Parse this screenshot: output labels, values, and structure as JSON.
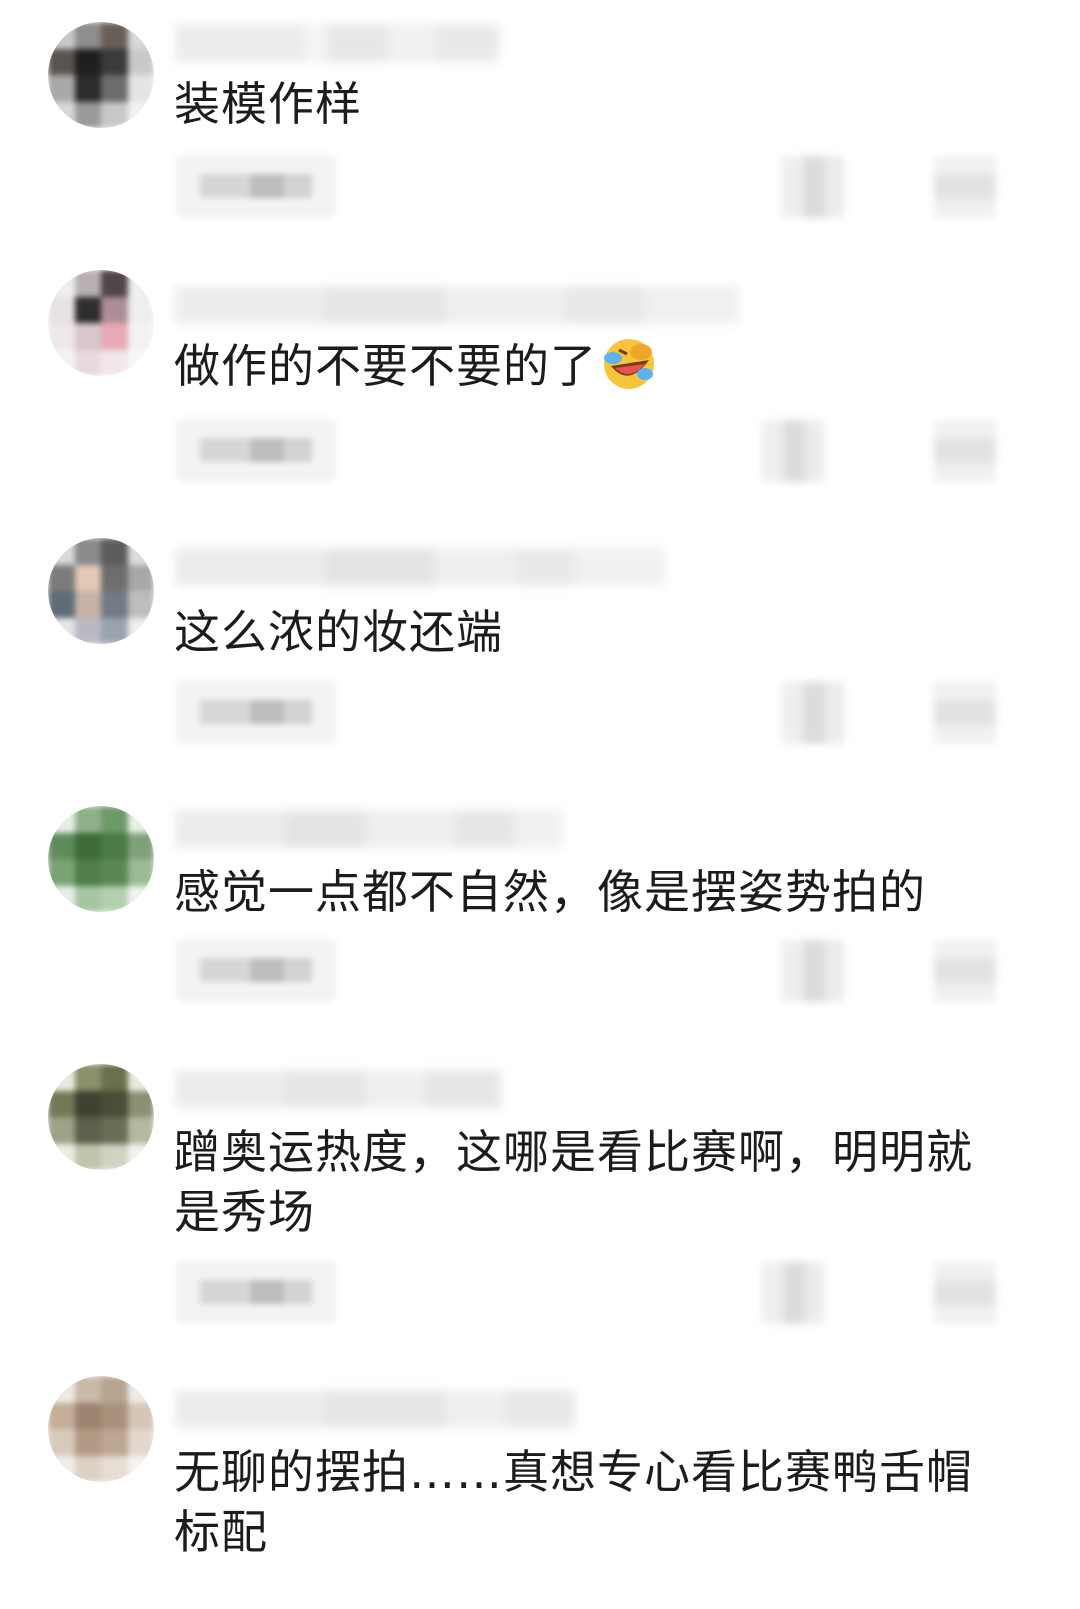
{
  "comments": [
    {
      "text": "装模作样",
      "has_emoji": false,
      "avatar_colors": [
        "#c8c8c8",
        "#8e8e8e",
        "#6a5f58",
        "#d9d9d9",
        "#5a5451",
        "#1f1f1f",
        "#3b3b3b",
        "#c9c9c9",
        "#a9a9a9",
        "#2c2c2c",
        "#6c6c6c",
        "#e4e4e4",
        "#d8d8d8",
        "#9a9a9a",
        "#c8c8c8",
        "#f2f2f2"
      ]
    },
    {
      "text": "做作的不要不要的了",
      "has_emoji": true,
      "emoji_icon": "rolling-laughing-icon",
      "avatar_colors": [
        "#eeeeee",
        "#b8b0b3",
        "#514549",
        "#eeeeee",
        "#e6e1e3",
        "#2f2d2f",
        "#ad8e97",
        "#eeeeee",
        "#efe7ea",
        "#d7c7cc",
        "#e6a9b5",
        "#f2f2f2",
        "#f3f3f3",
        "#e8d9dd",
        "#f2e8ea",
        "#f7f7f7"
      ]
    },
    {
      "text": "这么浓的妆还端",
      "has_emoji": false,
      "avatar_colors": [
        "#d9d9d9",
        "#8a8a8a",
        "#5c5c5c",
        "#dcdcdc",
        "#7c7c7c",
        "#e3c8b5",
        "#6e6e6e",
        "#a8a8a8",
        "#5f6c78",
        "#c6b3a6",
        "#727a85",
        "#bdbdbd",
        "#e6e6e6",
        "#b9b9c3",
        "#9aa4b0",
        "#eeeeee"
      ]
    },
    {
      "text": "感觉一点都不自然，像是摆姿势拍的",
      "has_emoji": false,
      "avatar_colors": [
        "#e6efe4",
        "#8fb18a",
        "#6e9a68",
        "#e9f0e8",
        "#5f8b5a",
        "#3c6b38",
        "#4a7a46",
        "#7ea178",
        "#7aa374",
        "#4f7d4b",
        "#5b8756",
        "#9bbb95",
        "#e7efe6",
        "#a7c5a2",
        "#b4cfb0",
        "#eef3ed"
      ]
    },
    {
      "text": "蹭奥运热度，这哪是看比赛啊，明明就是秀场",
      "has_emoji": false,
      "avatar_colors": [
        "#e8eade",
        "#8b8f6a",
        "#6b6f4d",
        "#e9ebe0",
        "#747856",
        "#3e4231",
        "#4a4d38",
        "#8c8f72",
        "#9fa287",
        "#5d604a",
        "#6a6d55",
        "#b6b89f",
        "#eceee4",
        "#c1c3ad",
        "#d1d2c2",
        "#f2f3ed"
      ]
    },
    {
      "text": "无聊的摆拍……真想专心看比赛鸭舌帽标配",
      "has_emoji": false,
      "avatar_colors": [
        "#efe9e3",
        "#c9b9a9",
        "#b7a491",
        "#efebe6",
        "#c3ae98",
        "#9a8470",
        "#a8927c",
        "#d5c6b7",
        "#d8cabb",
        "#b09a84",
        "#bda792",
        "#e2d7cc",
        "#f2ede8",
        "#ddd1c5",
        "#e6ddd4",
        "#f6f3ef"
      ]
    }
  ]
}
